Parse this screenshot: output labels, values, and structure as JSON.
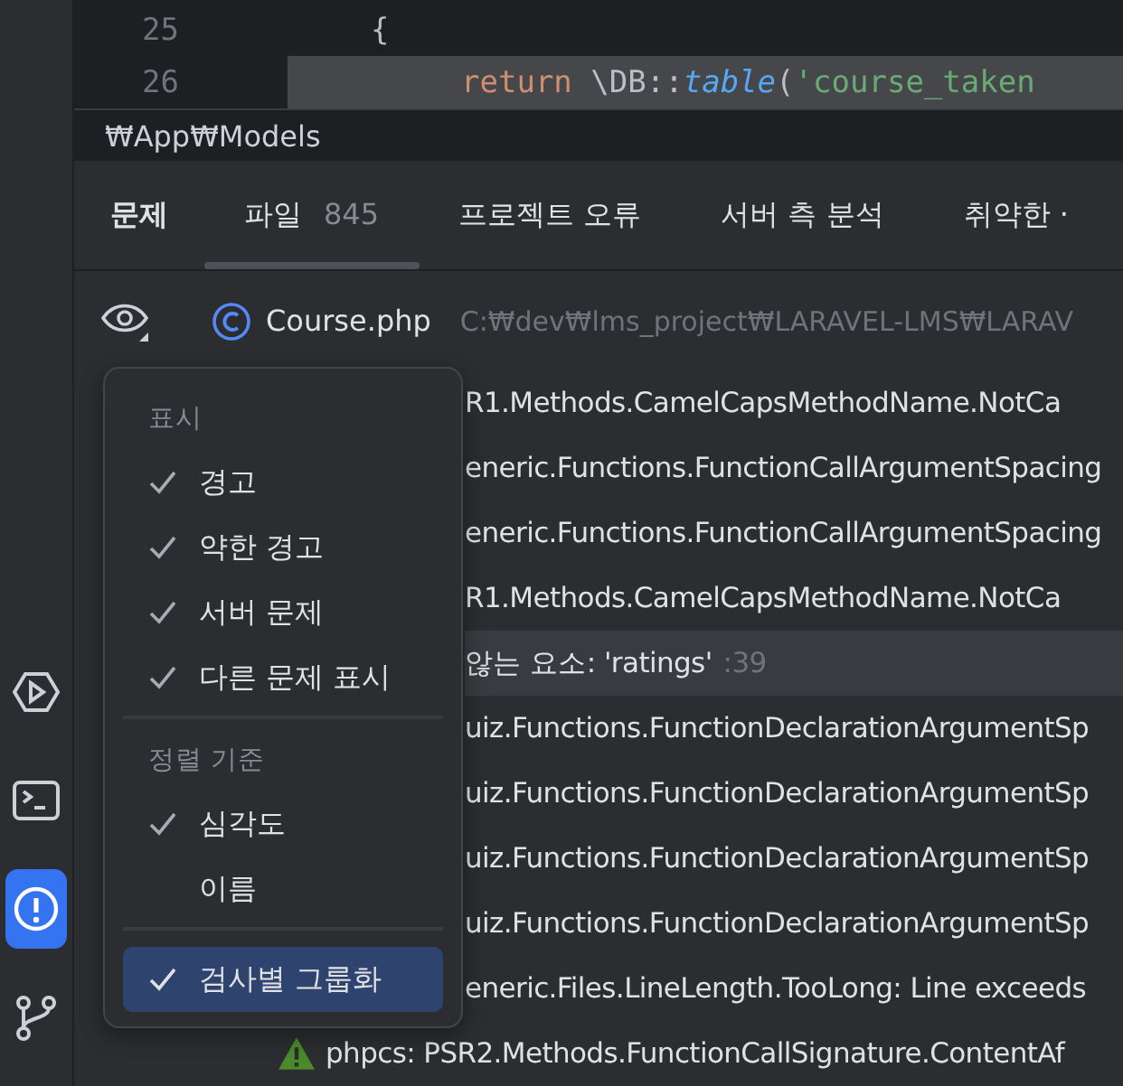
{
  "editor": {
    "lines": [
      {
        "number": "25",
        "tokens": [
          {
            "kind": "punct",
            "text": "{"
          }
        ],
        "highlighted": false
      },
      {
        "number": "26",
        "tokens": [
          {
            "kind": "keyword",
            "text": "return"
          },
          {
            "kind": "plain",
            "text": " \\DB::"
          },
          {
            "kind": "method",
            "text": "table"
          },
          {
            "kind": "punct",
            "text": "("
          },
          {
            "kind": "string",
            "text": "'course_taken"
          }
        ],
        "highlighted": true
      }
    ]
  },
  "breadcrumb": "₩App₩Models",
  "tabs": [
    {
      "label": "문제",
      "kind": "title"
    },
    {
      "label": "파일",
      "count": "845",
      "selected": true,
      "kind": "tab"
    },
    {
      "label": "프로젝트 오류",
      "selected": false,
      "kind": "tab"
    },
    {
      "label": "서버 측 분석",
      "selected": false,
      "kind": "tab"
    },
    {
      "label": "취약한 ·",
      "selected": false,
      "kind": "tab"
    }
  ],
  "file": {
    "name": "Course.php",
    "path": "C:₩dev₩lms_project₩LARAVEL-LMS₩LARAV"
  },
  "rows": [
    {
      "text": "R1.Methods.CamelCapsMethodName.NotCa",
      "selected": false,
      "warning": false
    },
    {
      "text": "eneric.Functions.FunctionCallArgumentSpacing",
      "selected": false,
      "warning": false
    },
    {
      "text": "eneric.Functions.FunctionCallArgumentSpacing",
      "selected": false,
      "warning": false
    },
    {
      "text": "R1.Methods.CamelCapsMethodName.NotCa",
      "selected": false,
      "warning": false
    },
    {
      "text": "않는 요소: 'ratings'",
      "line": ":39",
      "selected": true,
      "warning": false
    },
    {
      "text": "uiz.Functions.FunctionDeclarationArgumentSp",
      "selected": false,
      "warning": false
    },
    {
      "text": "uiz.Functions.FunctionDeclarationArgumentSp",
      "selected": false,
      "warning": false
    },
    {
      "text": "uiz.Functions.FunctionDeclarationArgumentSp",
      "selected": false,
      "warning": false
    },
    {
      "text": "uiz.Functions.FunctionDeclarationArgumentSp",
      "selected": false,
      "warning": false
    },
    {
      "text": "eneric.Files.LineLength.TooLong: Line exceeds",
      "selected": false,
      "warning": false
    },
    {
      "text": "phpcs: PSR2.Methods.FunctionCallSignature.ContentAf",
      "selected": false,
      "warning": true
    }
  ],
  "menu": {
    "items": [
      {
        "kind": "header",
        "label": "표시"
      },
      {
        "kind": "item",
        "label": "경고",
        "checked": true,
        "selected": false
      },
      {
        "kind": "item",
        "label": "약한 경고",
        "checked": true,
        "selected": false
      },
      {
        "kind": "item",
        "label": "서버 문제",
        "checked": true,
        "selected": false
      },
      {
        "kind": "item",
        "label": "다른 문제 표시",
        "checked": true,
        "selected": false
      },
      {
        "kind": "separator"
      },
      {
        "kind": "header",
        "label": "정렬 기준"
      },
      {
        "kind": "item",
        "label": "심각도",
        "checked": true,
        "selected": false
      },
      {
        "kind": "item",
        "label": "이름",
        "checked": false,
        "selected": false
      },
      {
        "kind": "separator"
      },
      {
        "kind": "item",
        "label": "검사별 그룹화",
        "checked": true,
        "selected": true
      }
    ]
  },
  "sidebar": {
    "items": [
      {
        "kind": "run",
        "selected": false
      },
      {
        "kind": "terminal",
        "selected": false
      },
      {
        "kind": "problems",
        "selected": true
      },
      {
        "kind": "git",
        "selected": false
      }
    ]
  }
}
